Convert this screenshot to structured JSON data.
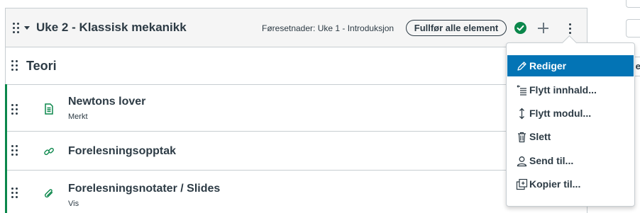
{
  "module": {
    "title": "Uke 2 - Klassisk mekanikk",
    "prerequisites": "Føresetnader: Uke 1 - Introduksjon",
    "complete_all_label": "Fullfør alle element",
    "published_color": "#0b874b"
  },
  "items": [
    {
      "type": "subheader",
      "title": "Teori",
      "icon": "none"
    },
    {
      "type": "page",
      "title": "Newtons lover",
      "subtitle": "Merkt",
      "icon": "document-icon"
    },
    {
      "type": "external-url",
      "title": "Forelesningsopptak",
      "icon": "link-icon"
    },
    {
      "type": "file",
      "title": "Forelesningsnotater / Slides",
      "subtitle": "Vis",
      "icon": "paperclip-icon"
    }
  ],
  "menu": {
    "items": [
      {
        "label": "Rediger",
        "icon": "pencil-icon",
        "active": true
      },
      {
        "label": "Flytt innhald...",
        "icon": "move-contents-icon"
      },
      {
        "label": "Flytt modul...",
        "icon": "move-vertical-icon"
      },
      {
        "label": "Slett",
        "icon": "trash-icon"
      },
      {
        "label": "Send til...",
        "icon": "user-icon"
      },
      {
        "label": "Kopier til...",
        "icon": "copy-icon"
      }
    ],
    "active_color": "#0374b5"
  },
  "right_edge": {
    "fragment": "je"
  }
}
